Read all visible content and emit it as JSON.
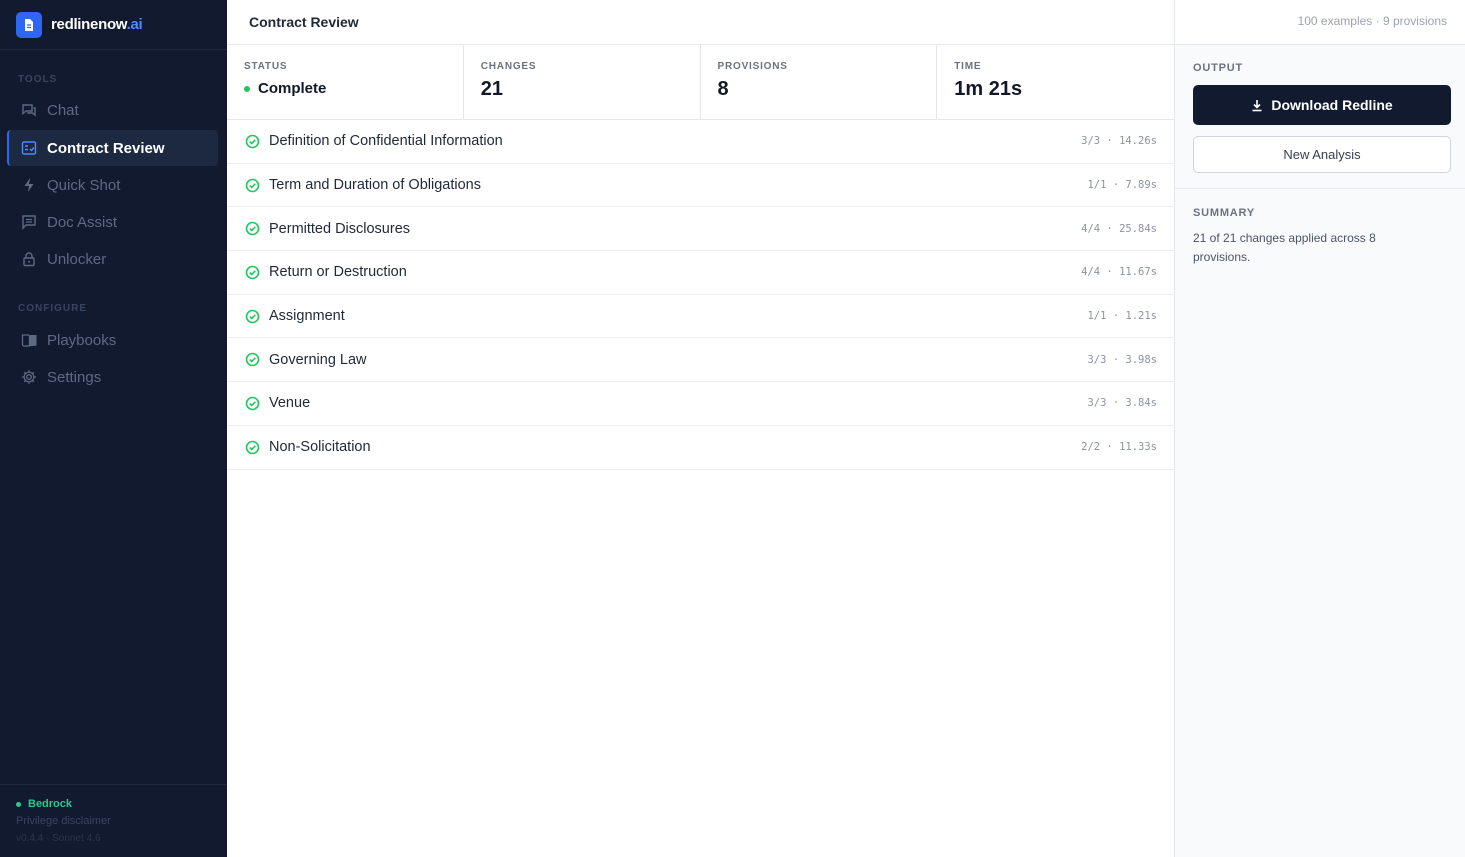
{
  "brand": {
    "name": "redlinenow",
    "suffix": ".ai"
  },
  "sidebar": {
    "tools_title": "TOOLS",
    "configure_title": "CONFIGURE",
    "tools": [
      {
        "label": "Chat",
        "icon": "chat-icon"
      },
      {
        "label": "Contract Review",
        "icon": "checklist-icon",
        "active": true
      },
      {
        "label": "Quick Shot",
        "icon": "bolt-icon"
      },
      {
        "label": "Doc Assist",
        "icon": "comment-icon"
      },
      {
        "label": "Unlocker",
        "icon": "lock-icon"
      }
    ],
    "configure": [
      {
        "label": "Playbooks",
        "icon": "book-icon"
      },
      {
        "label": "Settings",
        "icon": "gear-icon"
      }
    ],
    "footer": {
      "status": "Bedrock",
      "link": "Privilege disclaimer",
      "version": "v0.4.4 · Sonnet 4.6"
    }
  },
  "header": {
    "title": "Contract Review",
    "meta": "100 examples · 9 provisions"
  },
  "stats": {
    "status": {
      "label": "STATUS",
      "value": "Complete"
    },
    "changes": {
      "label": "CHANGES",
      "value": "21"
    },
    "provisions": {
      "label": "PROVISIONS",
      "value": "8"
    },
    "time": {
      "label": "TIME",
      "value": "1m 21s"
    }
  },
  "provisions": [
    {
      "name": "Definition of Confidential Information",
      "meta": "3/3 · 14.26s"
    },
    {
      "name": "Term and Duration of Obligations",
      "meta": "1/1 · 7.89s"
    },
    {
      "name": "Permitted Disclosures",
      "meta": "4/4 · 25.84s"
    },
    {
      "name": "Return or Destruction",
      "meta": "4/4 · 11.67s"
    },
    {
      "name": "Assignment",
      "meta": "1/1 · 1.21s"
    },
    {
      "name": "Governing Law",
      "meta": "3/3 · 3.98s"
    },
    {
      "name": "Venue",
      "meta": "3/3 · 3.84s"
    },
    {
      "name": "Non-Solicitation",
      "meta": "2/2 · 11.33s"
    }
  ],
  "output": {
    "title": "OUTPUT",
    "download_label": "Download Redline",
    "new_label": "New Analysis"
  },
  "summary": {
    "title": "SUMMARY",
    "text": "21 of 21 changes applied across 8 provisions."
  },
  "colors": {
    "accent": "#2f66f3",
    "sidebar_bg": "#111a2e",
    "success": "#22c55e"
  }
}
